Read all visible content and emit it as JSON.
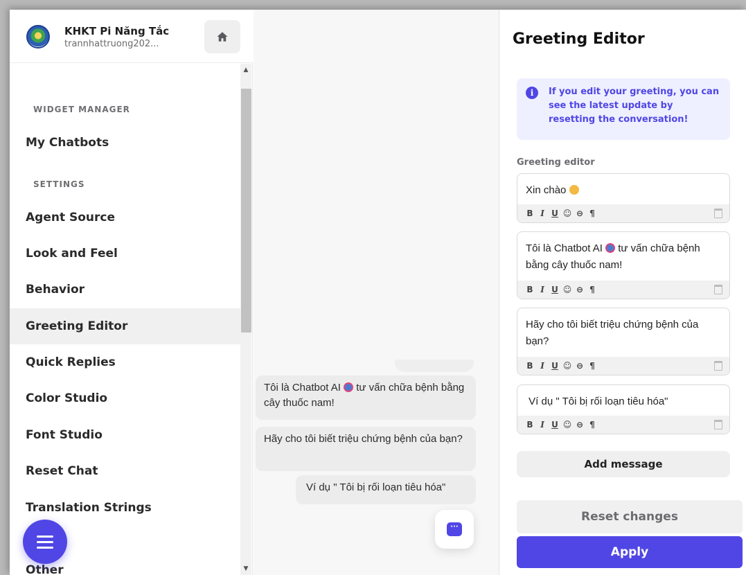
{
  "app": {
    "name": "KHKT Pi Năng Tắc",
    "user": "trannhattruong202..."
  },
  "sidebar": {
    "sections": [
      {
        "label": "WIDGET MANAGER"
      },
      {
        "label": "SETTINGS"
      }
    ],
    "items": [
      {
        "label": "My Chatbots"
      },
      {
        "label": "Agent Source"
      },
      {
        "label": "Look and Feel"
      },
      {
        "label": "Behavior"
      },
      {
        "label": "Greeting Editor"
      },
      {
        "label": "Quick Replies"
      },
      {
        "label": "Color Studio"
      },
      {
        "label": "Font Studio"
      },
      {
        "label": "Reset Chat"
      },
      {
        "label": "Translation Strings"
      },
      {
        "label": "Other"
      }
    ],
    "active_item": "Greeting Editor"
  },
  "preview": {
    "messages": [
      {
        "text_before": "Tôi là Chatbot AI",
        "text_after": "tư vấn chữa bệnh bằng cây thuốc nam!",
        "side": "bot"
      },
      {
        "text": "Hãy cho tôi biết triệu chứng bệnh của bạn?",
        "side": "bot"
      },
      {
        "text": "Ví dụ \" Tôi bị rối loạn tiêu hóa\"",
        "side": "user"
      }
    ],
    "launcher_glyph": "···"
  },
  "editor": {
    "title": "Greeting Editor",
    "info": "If you edit your greeting, you can see the latest update by resetting the conversation!",
    "label": "Greeting editor",
    "messages": [
      {
        "text": "Xin chào",
        "emoji": "wave-emoji"
      },
      {
        "text_before": "Tôi là Chatbot AI",
        "text_after": "tư vấn chữa bệnh bằng cây thuốc nam!",
        "emoji": "robot-emoji"
      },
      {
        "text": "Hãy cho tôi biết triệu chứng bệnh của bạn?"
      },
      {
        "text": " Ví dụ \" Tôi bị rối loạn tiêu hóa\""
      }
    ],
    "toolbar": {
      "bold": "B",
      "italic": "I",
      "underline": "U",
      "emoji": "☺",
      "link": "⊖",
      "paragraph": "¶"
    },
    "add_label": "Add message",
    "reset_label": "Reset changes",
    "apply_label": "Apply"
  },
  "colors": {
    "accent": "#5046e5",
    "info_bg": "#eef0ff",
    "active_item_bg": "#f0f0f1"
  }
}
